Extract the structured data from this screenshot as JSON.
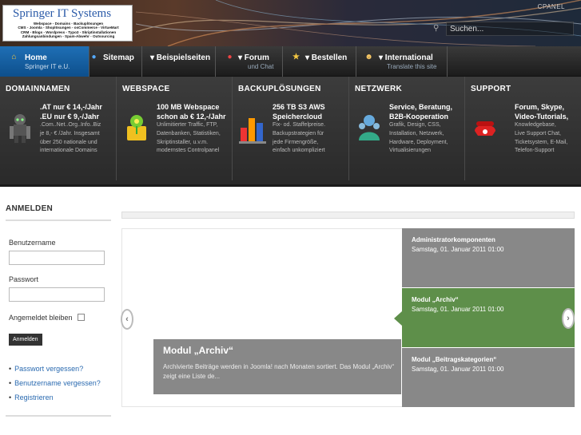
{
  "header": {
    "logo_title": "Springer IT Systems",
    "logo_lines": [
      "Webspace - Domains - Backuplösungen",
      "CMS - Joomla - Shoplösungen - osCommerce - VirtueMart",
      "CRM - Blogs - Wordpress - Typo3 - Skriptinstallationen",
      "Zahlungsanbindungen - Spam-Abwehr - Outsourcing"
    ],
    "cpanel": "CPANEL",
    "search_placeholder": "Suchen..."
  },
  "nav": [
    {
      "label": "Home",
      "sub": "Springer IT e.U.",
      "icon": "home-icon"
    },
    {
      "label": "Sitemap",
      "sub": "",
      "icon": "globe-icon"
    },
    {
      "label": "▾ Beispielseiten",
      "sub": "",
      "icon": ""
    },
    {
      "label": "▾ Forum",
      "sub": "und Chat",
      "icon": "forum-icon"
    },
    {
      "label": "▾ Bestellen",
      "sub": "",
      "icon": "star-icon"
    },
    {
      "label": "▾ International",
      "sub": "Translate this site",
      "icon": "people-icon"
    }
  ],
  "mega": [
    {
      "heading": "DOMAINNAMEN",
      "title": [
        ".AT nur € 14,-/Jahr",
        ".EU nur € 9,-/Jahr"
      ],
      "desc": [
        ".Com..Net..Org..Info..Biz",
        "je 8,- € /Jahr. Insgesamt",
        "über 250 nationale und",
        "internationale Domains"
      ]
    },
    {
      "heading": "WEBSPACE",
      "title": [
        "100 MB Webspace",
        "schon ab € 12,-/Jahr"
      ],
      "desc": [
        "Unlimitierter Traffic, FTP,",
        "Datenbanken, Statistiken,",
        "Skriptinstaller, u.v.m.",
        "modernstes Controlpanel"
      ]
    },
    {
      "heading": "BACKUPLÖSUNGEN",
      "title": [
        "256 TB S3 AWS",
        "Speichercloud"
      ],
      "desc": [
        "Fix- od. Staffelpreise.",
        "Backupstrategien für",
        "jede Firmengröße,",
        "einfach unkompliziert"
      ]
    },
    {
      "heading": "NETZWERK",
      "title": [
        "Service, Beratung,",
        "B2B-Kooperation"
      ],
      "desc": [
        "Grafik, Design, CSS,",
        "Installation, Netzwerk,",
        "Hardware, Deployment,",
        "Virtualisierungen"
      ]
    },
    {
      "heading": "SUPPORT",
      "title": [
        "Forum, Skype,",
        "Video-Tutorials,"
      ],
      "desc": [
        "Knowledgebase,",
        "Live Support Chat,",
        "Ticketsystem, E-Mail,",
        "Telefon-Support"
      ]
    }
  ],
  "login": {
    "title": "ANMELDEN",
    "username_label": "Benutzername",
    "password_label": "Passwort",
    "remember_label": "Angemeldet bleiben",
    "button": "Anmelden",
    "links": [
      "Passwort vergessen?",
      "Benutzername vergessen?",
      "Registrieren"
    ]
  },
  "slider": {
    "caption_title": "Modul „Archiv“",
    "caption_text": "Archivierte Beiträge werden in Joomla! nach Monaten sortiert. Das Modul „Archiv“ zeigt eine Liste de...",
    "prev": "‹",
    "next": "›",
    "tabs": [
      {
        "title": "Administratorkomponenten",
        "date": "Samstag, 01. Januar 2011 01:00"
      },
      {
        "title": "Modul „Archiv“",
        "date": "Samstag, 01. Januar 2011 01:00"
      },
      {
        "title": "Modul „Beitragskategorien“",
        "date": "Samstag, 01. Januar 2011 01:00"
      }
    ]
  },
  "colors": {
    "nav_active": "#1f6fb5",
    "tab_active": "#5e8f4a",
    "tab": "#888888",
    "link": "#2a6ab0"
  }
}
